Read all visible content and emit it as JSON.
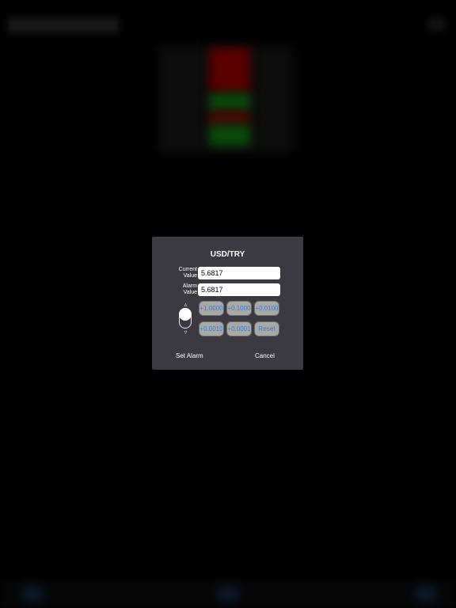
{
  "dialog": {
    "title": "USD/TRY",
    "current_label_line1": "Current",
    "current_label_line2": "Value",
    "current_value": "5.6817",
    "alarm_label_line1": "Alarm",
    "alarm_label_line2": "Value",
    "alarm_value": "5.6817",
    "stepper": {
      "up_symbol": "▵",
      "down_symbol": "▿",
      "state": "up"
    },
    "increment_buttons": [
      "+1.0000",
      "+0.1000",
      "+0.0100",
      "+0.0010",
      "+0.0001",
      "Reset"
    ],
    "set_alarm_label": "Set Alarm",
    "cancel_label": "Cancel"
  },
  "colors": {
    "overlay_bg": "#000000",
    "dialog_bg": "#3a3a40",
    "button_bg": "#a9a9a9",
    "button_text": "#2f7fd6",
    "text": "#ffffff",
    "bg_red": "#5a0000",
    "bg_green": "#0a4a0a"
  }
}
